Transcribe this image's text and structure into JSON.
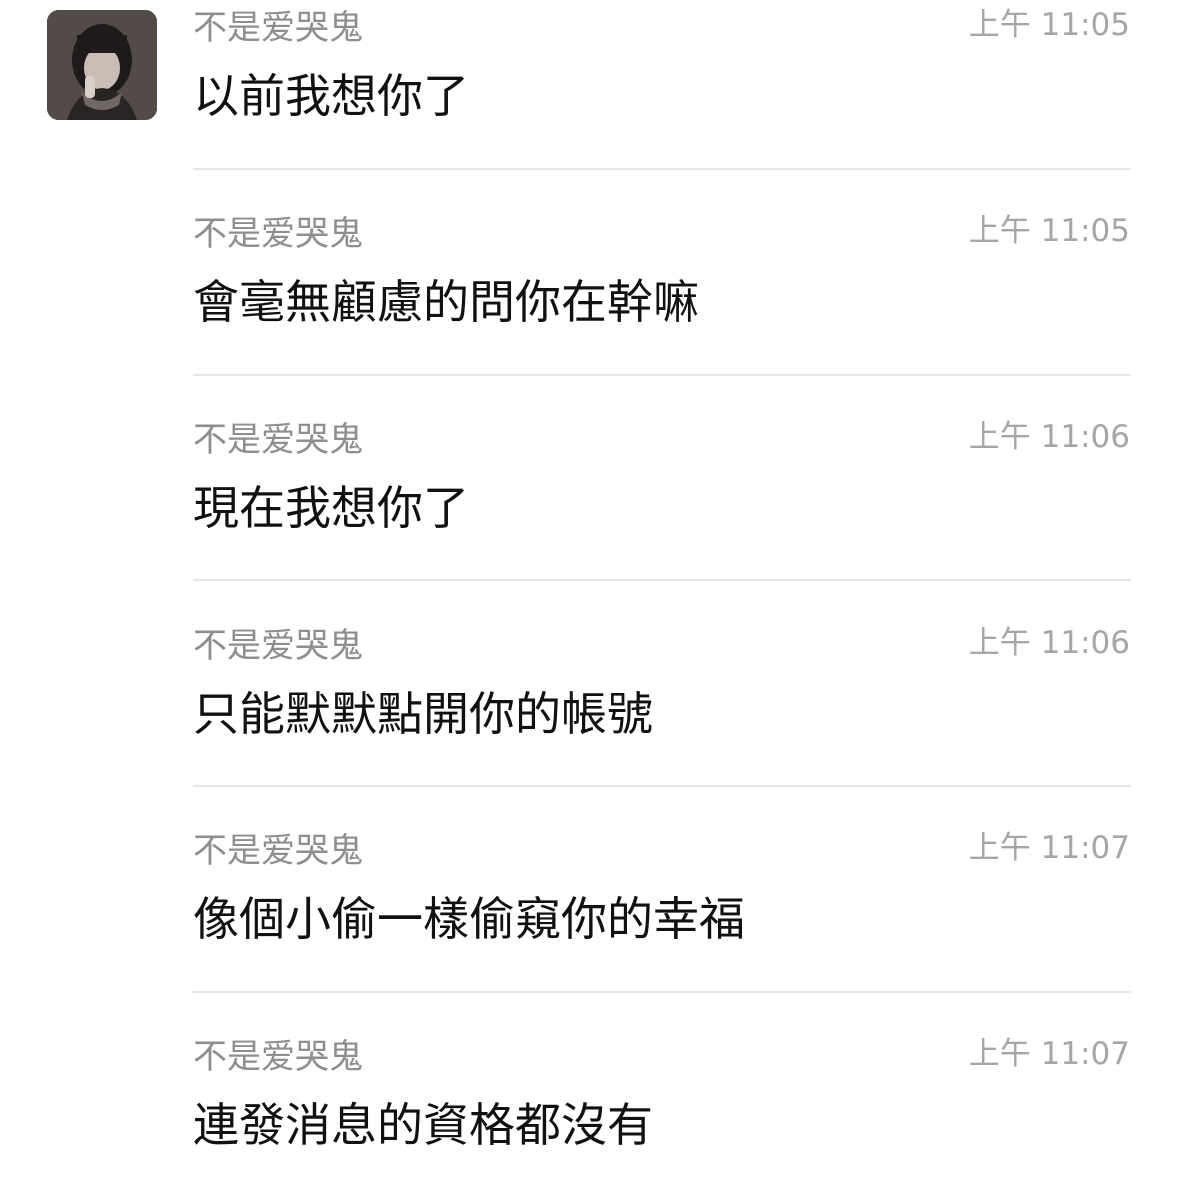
{
  "chat": {
    "messages": [
      {
        "sender": "不是爱哭鬼",
        "time": "上午 11:05",
        "text": "以前我想你了"
      },
      {
        "sender": "不是爱哭鬼",
        "time": "上午 11:05",
        "text": "會毫無顧慮的問你在幹嘛"
      },
      {
        "sender": "不是爱哭鬼",
        "time": "上午 11:06",
        "text": "現在我想你了"
      },
      {
        "sender": "不是爱哭鬼",
        "time": "上午 11:06",
        "text": "只能默默點開你的帳號"
      },
      {
        "sender": "不是爱哭鬼",
        "time": "上午 11:07",
        "text": "像個小偷一樣偷窺你的幸福"
      },
      {
        "sender": "不是爱哭鬼",
        "time": "上午 11:07",
        "text": "連發消息的資格都沒有"
      }
    ]
  },
  "colors": {
    "background": "#ffffff",
    "sender_text": "#8e8e8e",
    "time_text": "#a6a6a6",
    "message_text": "#111111",
    "divider": "#e6e6e6"
  }
}
